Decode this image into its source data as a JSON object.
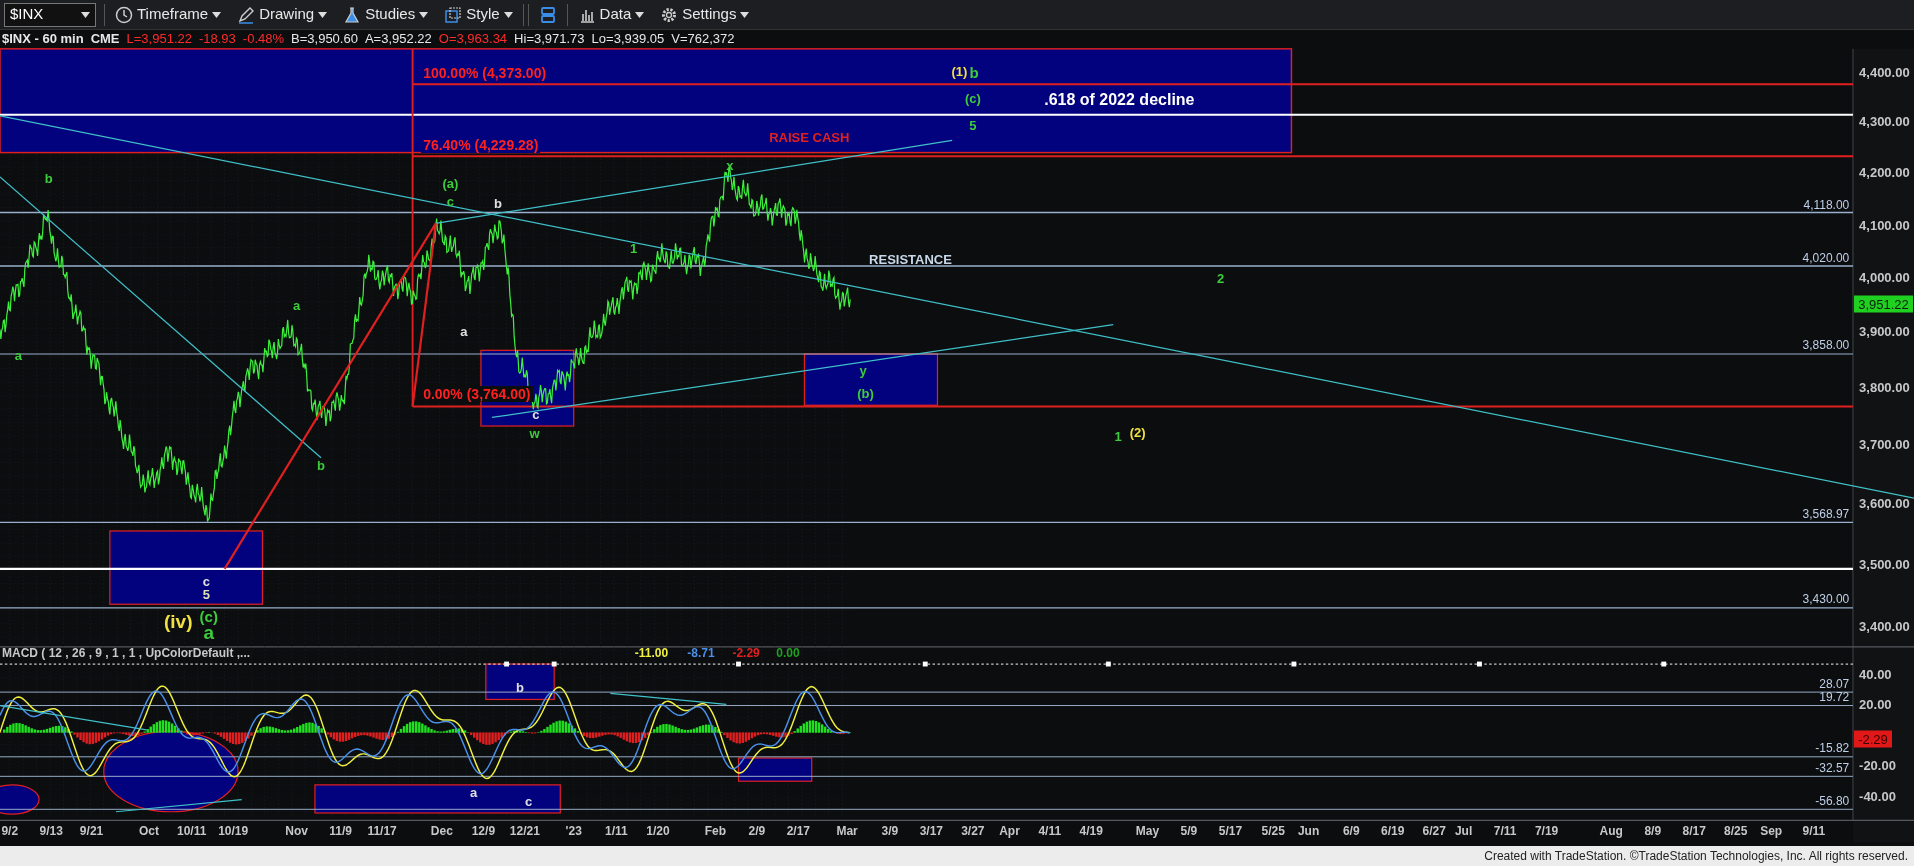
{
  "toolbar": {
    "symbol": "$INX",
    "items": [
      {
        "kind": "clock",
        "label": "Timeframe"
      },
      {
        "kind": "pencil",
        "label": "Drawing"
      },
      {
        "kind": "flask",
        "label": "Studies"
      },
      {
        "kind": "style",
        "label": "Style"
      },
      {
        "kind": "layout"
      },
      {
        "kind": "bars",
        "label": "Data"
      },
      {
        "kind": "gear",
        "label": "Settings"
      }
    ]
  },
  "quote": {
    "title": "$INX - 60 min",
    "exchange": "CME",
    "fields": [
      {
        "text": "L=3,951.22",
        "color": "#ff2b2b"
      },
      {
        "text": "-18.93",
        "color": "#ff2b2b"
      },
      {
        "text": "-0.48%",
        "color": "#ff2b2b"
      },
      {
        "text": "B=3,950.60",
        "color": "#e8e8e8"
      },
      {
        "text": "A=3,952.22",
        "color": "#e8e8e8"
      },
      {
        "text": "O=3,963.34",
        "color": "#ff2b2b"
      },
      {
        "text": "Hi=3,971.73",
        "color": "#e8e8e8"
      },
      {
        "text": "Lo=3,939.05",
        "color": "#e8e8e8"
      },
      {
        "text": "V=762,372",
        "color": "#e8e8e8"
      }
    ]
  },
  "price_pane": {
    "axis_labels": [
      "4,400.00",
      "4,300.00",
      "4,200.00",
      "4,100.00",
      "4,000.00",
      "3,900.00",
      "3,800.00",
      "3,700.00",
      "3,600.00",
      "3,500.00",
      "3,400.00"
    ],
    "last_price": "3,951.22",
    "level_labels": [
      "4,118.00",
      "4,020.00",
      "3,858.00",
      "3,568.97",
      "3,430.00"
    ],
    "annotations": [
      {
        "kind": "minor",
        "text": "b",
        "color": "#3ccc3c"
      },
      {
        "kind": "minor",
        "text": "a",
        "color": "#3ccc3c"
      },
      {
        "kind": "minor",
        "text": "a",
        "color": "#3ccc3c"
      },
      {
        "kind": "minor",
        "text": "b",
        "color": "#3ccc3c"
      },
      {
        "kind": "minor",
        "text": "c",
        "color": "#e0e0e0"
      },
      {
        "kind": "minor",
        "text": "5",
        "color": "#e0e0b0"
      },
      {
        "kind": "medium",
        "text": "(c)",
        "color": "#3ccc3c"
      },
      {
        "kind": "major",
        "text": "(iv)",
        "color": "#f0e040"
      },
      {
        "kind": "major",
        "text": "a",
        "color": "#3ccc3c"
      },
      {
        "kind": "minor",
        "text": "(a)",
        "color": "#3ccc3c"
      },
      {
        "kind": "minor",
        "text": "c",
        "color": "#3ccc3c"
      },
      {
        "kind": "minor",
        "text": "b",
        "color": "#e0e0e0"
      },
      {
        "kind": "minor",
        "text": "a",
        "color": "#e0e0e0"
      },
      {
        "kind": "minor",
        "text": "c",
        "color": "#e0e0e0"
      },
      {
        "kind": "minor",
        "text": "w",
        "color": "#3ccc3c"
      },
      {
        "kind": "minor",
        "text": "1",
        "color": "#3ccc3c"
      },
      {
        "kind": "minor",
        "text": "x",
        "color": "#3ccc3c"
      },
      {
        "kind": "minor",
        "text": "y",
        "color": "#3ccc3c"
      },
      {
        "kind": "minor",
        "text": "(b)",
        "color": "#3ccc3c"
      },
      {
        "kind": "minor",
        "text": "2",
        "color": "#3ccc3c"
      },
      {
        "kind": "minor",
        "text": "1",
        "color": "#3ccc3c"
      },
      {
        "kind": "minor",
        "text": "(2)",
        "color": "#f0e040"
      },
      {
        "kind": "minor",
        "text": "(1)",
        "color": "#f0e040"
      },
      {
        "kind": "medium",
        "text": "b",
        "color": "#3ccc3c"
      },
      {
        "kind": "minor",
        "text": "(c)",
        "color": "#3ccc3c"
      },
      {
        "kind": "minor",
        "text": "5",
        "color": "#3ccc3c"
      },
      {
        "kind": "note",
        "text": "RAISE CASH",
        "color": "#e02020"
      },
      {
        "kind": "title",
        "text": ".618 of 2022 decline",
        "color": "#ffffff"
      },
      {
        "kind": "fib",
        "text": "100.00% (4,373.00)",
        "color": "#ff2020"
      },
      {
        "kind": "fib",
        "text": "76.40% (4,229.28)",
        "color": "#ff2020"
      },
      {
        "kind": "fib",
        "text": "0.00% (3,764.00)",
        "color": "#ff2020"
      },
      {
        "kind": "note",
        "text": "RESISTANCE",
        "color": "#c8d8e8"
      }
    ]
  },
  "macd_pane": {
    "title": "MACD ( 12 , 26 , 9 , 1 , 1 , UpColorDefault ,...",
    "values": [
      {
        "text": "-11.00",
        "color": "#f0f040"
      },
      {
        "text": "-8.71",
        "color": "#4a90e8"
      },
      {
        "text": "-2.29",
        "color": "#e02020"
      },
      {
        "text": "0.00",
        "color": "#20a020"
      }
    ],
    "axis_labels": [
      "40.00",
      "20.00",
      "-20.00",
      "-40.00"
    ],
    "last_value": "-2.29",
    "level_labels": [
      "28.07",
      "19.72",
      "-15.82",
      "-32.57",
      "-56.80"
    ],
    "annotations": [
      {
        "text": "b"
      },
      {
        "text": "a"
      },
      {
        "text": "c"
      }
    ]
  },
  "date_axis": [
    "9/2",
    "9/13",
    "9/21",
    "Oct",
    "10/11",
    "10/19",
    "Nov",
    "11/9",
    "11/17",
    "Dec",
    "12/9",
    "12/21",
    "'23",
    "1/11",
    "1/20",
    "Feb",
    "2/9",
    "2/17",
    "Mar",
    "3/9",
    "3/17",
    "3/27",
    "Apr",
    "4/11",
    "4/19",
    "May",
    "5/9",
    "5/17",
    "5/25",
    "Jun",
    "6/9",
    "6/19",
    "6/27",
    "Jul",
    "7/11",
    "7/19",
    "Aug",
    "8/9",
    "8/17",
    "8/25",
    "Sep",
    "9/11"
  ],
  "credit": "Created with TradeStation. ©TradeStation Technologies, Inc. All rights reserved."
}
